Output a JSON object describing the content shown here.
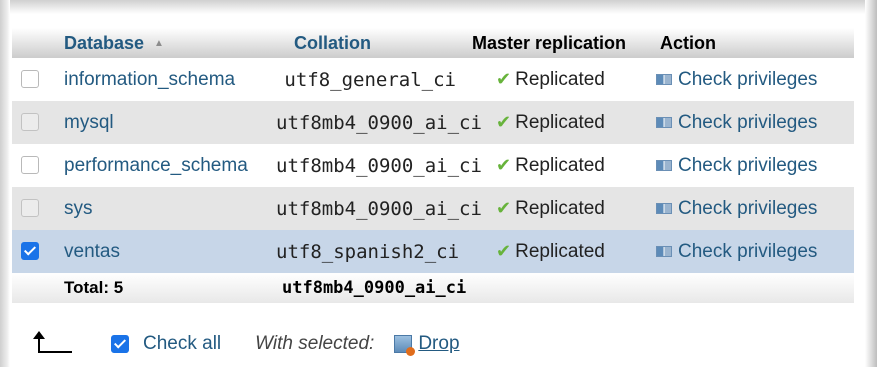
{
  "table": {
    "headers": {
      "database": "Database",
      "collation": "Collation",
      "master_replication": "Master replication",
      "action": "Action"
    },
    "rows": [
      {
        "name": "information_schema",
        "collation": "utf8_general_ci",
        "replication": "Replicated",
        "action": "Check privileges",
        "checked": false
      },
      {
        "name": "mysql",
        "collation": "utf8mb4_0900_ai_ci",
        "replication": "Replicated",
        "action": "Check privileges",
        "checked": false
      },
      {
        "name": "performance_schema",
        "collation": "utf8mb4_0900_ai_ci",
        "replication": "Replicated",
        "action": "Check privileges",
        "checked": false
      },
      {
        "name": "sys",
        "collation": "utf8mb4_0900_ai_ci",
        "replication": "Replicated",
        "action": "Check privileges",
        "checked": false
      },
      {
        "name": "ventas",
        "collation": "utf8_spanish2_ci",
        "replication": "Replicated",
        "action": "Check privileges",
        "checked": true
      }
    ],
    "total_label": "Total: 5",
    "total_collation": "utf8mb4_0900_ai_ci"
  },
  "footer": {
    "check_all_label": "Check all",
    "with_selected_label": "With selected:",
    "drop_label": "Drop"
  },
  "icons": {
    "sort": "sort-ascending-icon",
    "replicated": "checkmark-icon",
    "privileges": "privileges-icon",
    "select_arrow": "arrow-up-icon",
    "drop": "drop-table-icon"
  },
  "colors": {
    "link": "#235a81",
    "selected_row": "#c7d6e8",
    "checkbox_checked": "#1a73e8",
    "replicated_tick": "#67b33b"
  }
}
